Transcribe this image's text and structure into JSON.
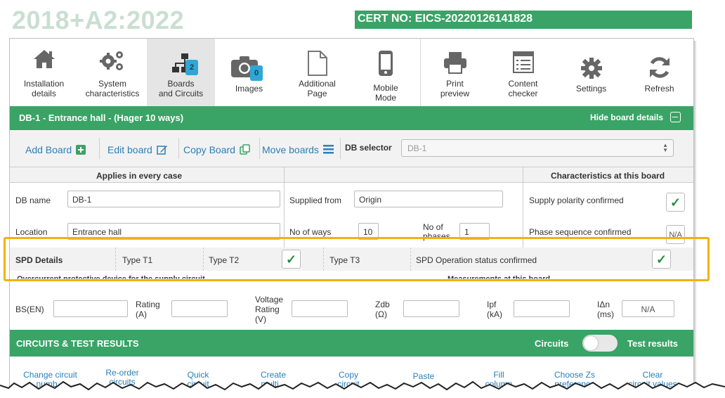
{
  "header": {
    "edition": "2018+A2:2022",
    "cert_no": "CERT NO: EICS-20220126141828"
  },
  "toolbar": {
    "items": [
      {
        "label_1": "Installation",
        "label_2": "details",
        "icon": "house-icon"
      },
      {
        "label_1": "System",
        "label_2": "characteristics",
        "icon": "gears-icon"
      },
      {
        "label_1": "Boards",
        "label_2": "and Circuits",
        "icon": "sitemap-icon",
        "badge": "2",
        "active": true
      },
      {
        "label_1": "Images",
        "label_2": "",
        "icon": "camera-icon",
        "badge": "0"
      },
      {
        "label_1": "Additional",
        "label_2": "Page",
        "icon": "page-icon"
      },
      {
        "label_1": "Mobile",
        "label_2": "Mode",
        "icon": "mobile-icon"
      },
      {
        "label_1": "Print",
        "label_2": "preview",
        "icon": "printer-icon"
      },
      {
        "label_1": "Content",
        "label_2": "checker",
        "icon": "checklist-icon"
      },
      {
        "label_1": "Settings",
        "label_2": "",
        "icon": "gear-icon"
      },
      {
        "label_1": "Refresh",
        "label_2": "",
        "icon": "refresh-icon"
      }
    ]
  },
  "board": {
    "title": "DB-1 - Entrance hall - (Hager 10 ways)",
    "hide_label": "Hide board details"
  },
  "actions": {
    "add_board": "Add Board",
    "edit_board": "Edit board",
    "copy_board": "Copy Board",
    "move_boards": "Move boards",
    "db_selector_label": "DB selector",
    "db_selector_value": "DB-1"
  },
  "sections": {
    "applies": "Applies in every case",
    "characteristics": "Characteristics at this board"
  },
  "fields": {
    "db_name_label": "DB name",
    "db_name_value": "DB-1",
    "location_label": "Location",
    "location_value": "Entrance hall",
    "supplied_from_label": "Supplied from",
    "supplied_from_value": "Origin",
    "no_of_ways_label": "No of ways",
    "no_of_ways_value": "10",
    "no_of_phases_label_1": "No of",
    "no_of_phases_label_2": "phases",
    "no_of_phases_value": "1",
    "supply_polarity_label": "Supply polarity confirmed",
    "supply_polarity_value": "✓",
    "phase_sequence_label": "Phase sequence confirmed",
    "phase_sequence_value": "N/A"
  },
  "spd": {
    "title": "SPD Details",
    "t1": "Type T1",
    "t2": "Type T2",
    "t2_value": "✓",
    "t3": "Type T3",
    "op_status": "SPD Operation status confirmed",
    "op_status_value": "✓"
  },
  "partial_headers": {
    "overcurrent": "Overcurrent protective device for the supply circuit",
    "measurements": "Measurements at this board"
  },
  "ocpd": {
    "bs_label": "BS(EN)",
    "rating_label_1": "Rating",
    "rating_label_2": "(A)",
    "voltage_label_1": "Voltage",
    "voltage_label_2": "Rating",
    "voltage_label_3": "(V)",
    "zdb_label_1": "Zdb",
    "zdb_label_2": "(Ω)",
    "ipf_label_1": "Ipf",
    "ipf_label_2": "(kA)",
    "idn_label_1": "IΔn",
    "idn_label_2": "(ms)",
    "idn_value": "N/A"
  },
  "circuits": {
    "title": "CIRCUITS & TEST RESULTS",
    "toggle_left": "Circuits",
    "toggle_right": "Test results"
  },
  "bottom_actions": [
    {
      "l1": "Change circuit",
      "l2": "numb..."
    },
    {
      "l1": "Re-order",
      "l2": "circuits"
    },
    {
      "l1": "Quick",
      "l2": "circuit"
    },
    {
      "l1": "Create",
      "l2": "multi..."
    },
    {
      "l1": "Copy",
      "l2": "circuit"
    },
    {
      "l1": "Paste",
      "l2": ""
    },
    {
      "l1": "Fill",
      "l2": "column"
    },
    {
      "l1": "Choose Zs",
      "l2": "preference"
    },
    {
      "l1": "Clear",
      "l2": "circuit values"
    }
  ],
  "colors": {
    "brand_green": "#3aa366",
    "link_blue": "#2a7fb8",
    "highlight": "#f0b20d",
    "badge": "#2fa7d6"
  }
}
